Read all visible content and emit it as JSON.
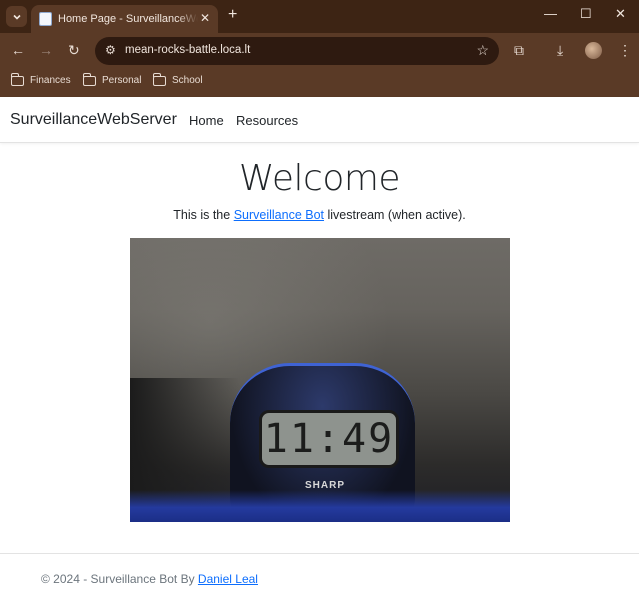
{
  "browser": {
    "tab_title": "Home Page - SurveillanceWebServer",
    "url": "mean-rocks-battle.loca.lt",
    "bookmarks": [
      "Finances",
      "Personal",
      "School"
    ]
  },
  "site": {
    "brand": "SurveillanceWebServer",
    "nav": [
      "Home",
      "Resources"
    ]
  },
  "main": {
    "heading": "Welcome",
    "intro_before": "This is the ",
    "intro_link": "Surveillance Bot",
    "intro_after": " livestream (when active).",
    "stream": {
      "clock_time": "11:49",
      "clock_brand": "SHARP"
    }
  },
  "footer": {
    "text": "© 2024 - Surveillance Bot By ",
    "author_link": "Daniel Leal"
  },
  "colors": {
    "chrome_dark": "#3d2414",
    "chrome": "#5a3a26",
    "link": "#0d6efd"
  }
}
